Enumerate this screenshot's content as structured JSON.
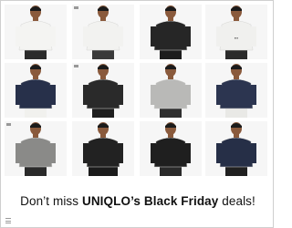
{
  "ad": {
    "headline": {
      "prefix": "Don’t miss ",
      "brand": "UNIQLO’s",
      "middle": " ",
      "event": "Black Friday",
      "suffix": " deals!"
    }
  },
  "products": [
    {
      "garment": "white crew-neck t-shirt",
      "color": "#f4f4f2",
      "pants": "#2b2b2b",
      "hasLogo": false,
      "selected": false
    },
    {
      "garment": "white oversized t-shirt",
      "color": "#f2f2f0",
      "pants": "#3a3a3a",
      "hasLogo": true,
      "selected": false
    },
    {
      "garment": "black overshirt jacket",
      "color": "#262626",
      "pants": "#1d1d1d",
      "hasLogo": false,
      "selected": false
    },
    {
      "garment": "white graphic t-shirt (back)",
      "color": "#f0f0ee",
      "pants": "#2b2b2b",
      "hasLogo": false,
      "selected": true
    },
    {
      "garment": "navy crew-neck sweater",
      "color": "#27304a",
      "pants": "#f1f1ee",
      "hasLogo": false,
      "selected": false
    },
    {
      "garment": "black cardigan",
      "color": "#2a2a2a",
      "pants": "#1e1e1e",
      "hasLogo": true,
      "selected": false
    },
    {
      "garment": "grey crew-neck sweater",
      "color": "#b9b9b7",
      "pants": "#2f2f2f",
      "hasLogo": false,
      "selected": false
    },
    {
      "garment": "navy knit sweater",
      "color": "#2c3550",
      "pants": "#e9e9e6",
      "hasLogo": false,
      "selected": false
    },
    {
      "garment": "grey sweater with white tee",
      "color": "#8a8a88",
      "pants": "#2a2a2a",
      "hasLogo": true,
      "selected": false
    },
    {
      "garment": "black jacket seated",
      "color": "#222222",
      "pants": "#1b1b1b",
      "hasLogo": false,
      "selected": false
    },
    {
      "garment": "black patterned sweater",
      "color": "#1f1f1f",
      "pants": "#2a2a2a",
      "hasLogo": false,
      "selected": false
    },
    {
      "garment": "navy crew-neck sweater",
      "color": "#262f47",
      "pants": "#202020",
      "hasLogo": false,
      "selected": false
    }
  ],
  "colors": {
    "selection": "#d8262c",
    "tileBg": "#f6f6f6",
    "skin": "#8a5a3c"
  },
  "icons": {
    "menu": "menu-icon"
  }
}
